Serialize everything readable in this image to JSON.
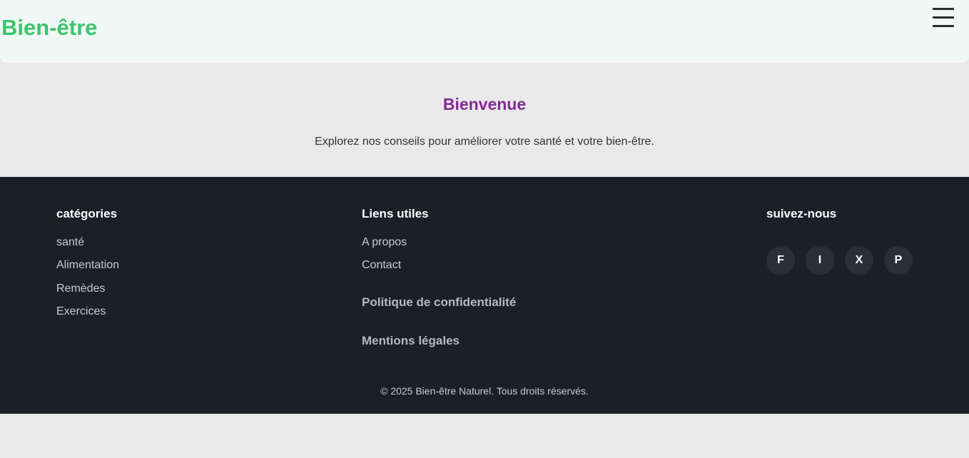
{
  "header": {
    "logo": "Bien-être",
    "menu_icon": "hamburger-menu-icon"
  },
  "hero": {
    "title": "Bienvenue",
    "text": "Explorez nos conseils pour améliorer votre santé et votre bien-être."
  },
  "footer": {
    "categories": {
      "title": "catégories",
      "items": [
        "santé",
        "Alimentation",
        "Remèdes",
        "Exercices"
      ]
    },
    "links": {
      "title": "Liens utiles",
      "items": [
        "A propos",
        "Contact"
      ],
      "privacy": "Politique de confidentialité",
      "legal": "Mentions légales"
    },
    "social": {
      "title": "suivez-nous",
      "items": [
        "F",
        "I",
        "X",
        "P"
      ]
    },
    "copyright": "© 2025 Bien-être Naturel. Tous droits réservés."
  },
  "colors": {
    "brand_green": "#3cc66f",
    "accent_purple": "#822a96",
    "header_bg": "#eff8f5",
    "page_bg": "#eae9e9",
    "footer_bg": "#1d1f27",
    "social_bg": "#2c2f38"
  }
}
